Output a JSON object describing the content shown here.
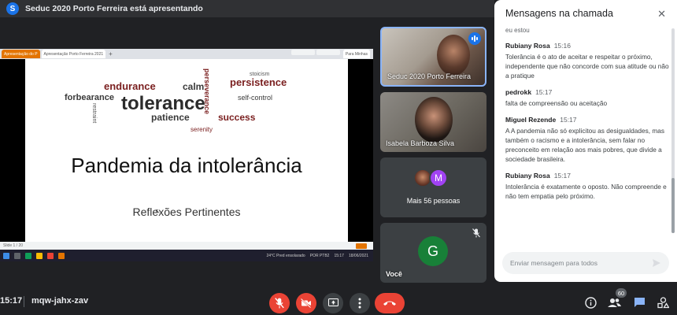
{
  "banner": {
    "avatar_letter": "S",
    "text": "Seduc 2020 Porto Ferreira está apresentando"
  },
  "shared_screen": {
    "browser_tabs": [
      "Apresentação do P",
      "Apresentação Porto Ferreira 2021",
      "Para Minhas"
    ],
    "slide": {
      "title": "Pandemia da intolerância",
      "subtitle": "Reflexões Pertinentes",
      "wordcloud": [
        {
          "text": "tolerance",
          "color": "#2b2b2b",
          "weight": "bold"
        },
        {
          "text": "endurance",
          "color": "#7a1f1f"
        },
        {
          "text": "calm",
          "color": "#3a3a3a"
        },
        {
          "text": "persistence",
          "color": "#7a1f1f"
        },
        {
          "text": "forbearance",
          "color": "#3a3a3a"
        },
        {
          "text": "patience",
          "color": "#3a3a3a"
        },
        {
          "text": "success",
          "color": "#7a1f1f"
        },
        {
          "text": "self-control",
          "color": "#3a3a3a"
        },
        {
          "text": "serenity",
          "color": "#7a1f1f"
        },
        {
          "text": "stoicism",
          "color": "#555555"
        },
        {
          "text": "perseverance",
          "color": "#7a1f1f"
        },
        {
          "text": "restraint",
          "color": "#555555"
        }
      ]
    },
    "status_text": "Slide 1 / 20",
    "taskbar_status": [
      "24°C Pred ensolarado",
      "POR PTB2",
      "15:17",
      "18/06/2021"
    ]
  },
  "participants": [
    {
      "name": "Seduc 2020 Porto Ferreira",
      "speaking": true
    },
    {
      "name": "Isabela Barboza Silva"
    },
    {
      "name": "Mais 56 pessoas",
      "avatar_letter": "M",
      "avatar_color": "#a142f4"
    },
    {
      "name": "Você",
      "avatar_letter": "G",
      "avatar_color": "#188038",
      "muted": true
    }
  ],
  "chat": {
    "title": "Mensagens na chamada",
    "partial_top": "eu estou",
    "messages": [
      {
        "sender": "Rubiany Rosa",
        "time": "15:16",
        "text": "Tolerância é o ato de aceitar e respeitar o próximo, independente que não concorde com sua atitude ou não a pratique"
      },
      {
        "sender": "pedrokk",
        "time": "15:17",
        "text": "falta de compreensão ou aceitação"
      },
      {
        "sender": "Miguel Rezende",
        "time": "15:17",
        "text": "A A pandemia não só explicitou as desigualdades, mas também o racismo e a intolerância, sem falar no preconceito em relação aos mais pobres, que divide a sociedade brasileira."
      },
      {
        "sender": "Rubiany Rosa",
        "time": "15:17",
        "text": "Intolerância é exatamente o oposto. Não compreende e não tem empatia pelo próximo."
      }
    ],
    "input_placeholder": "Enviar mensagem para todos"
  },
  "bottom_bar": {
    "clock": "15:17",
    "meeting_code": "mqw-jahx-zav",
    "participants_count": "60"
  },
  "colors": {
    "accent": "#1a73e8",
    "danger": "#ea4335",
    "background": "#202124"
  }
}
